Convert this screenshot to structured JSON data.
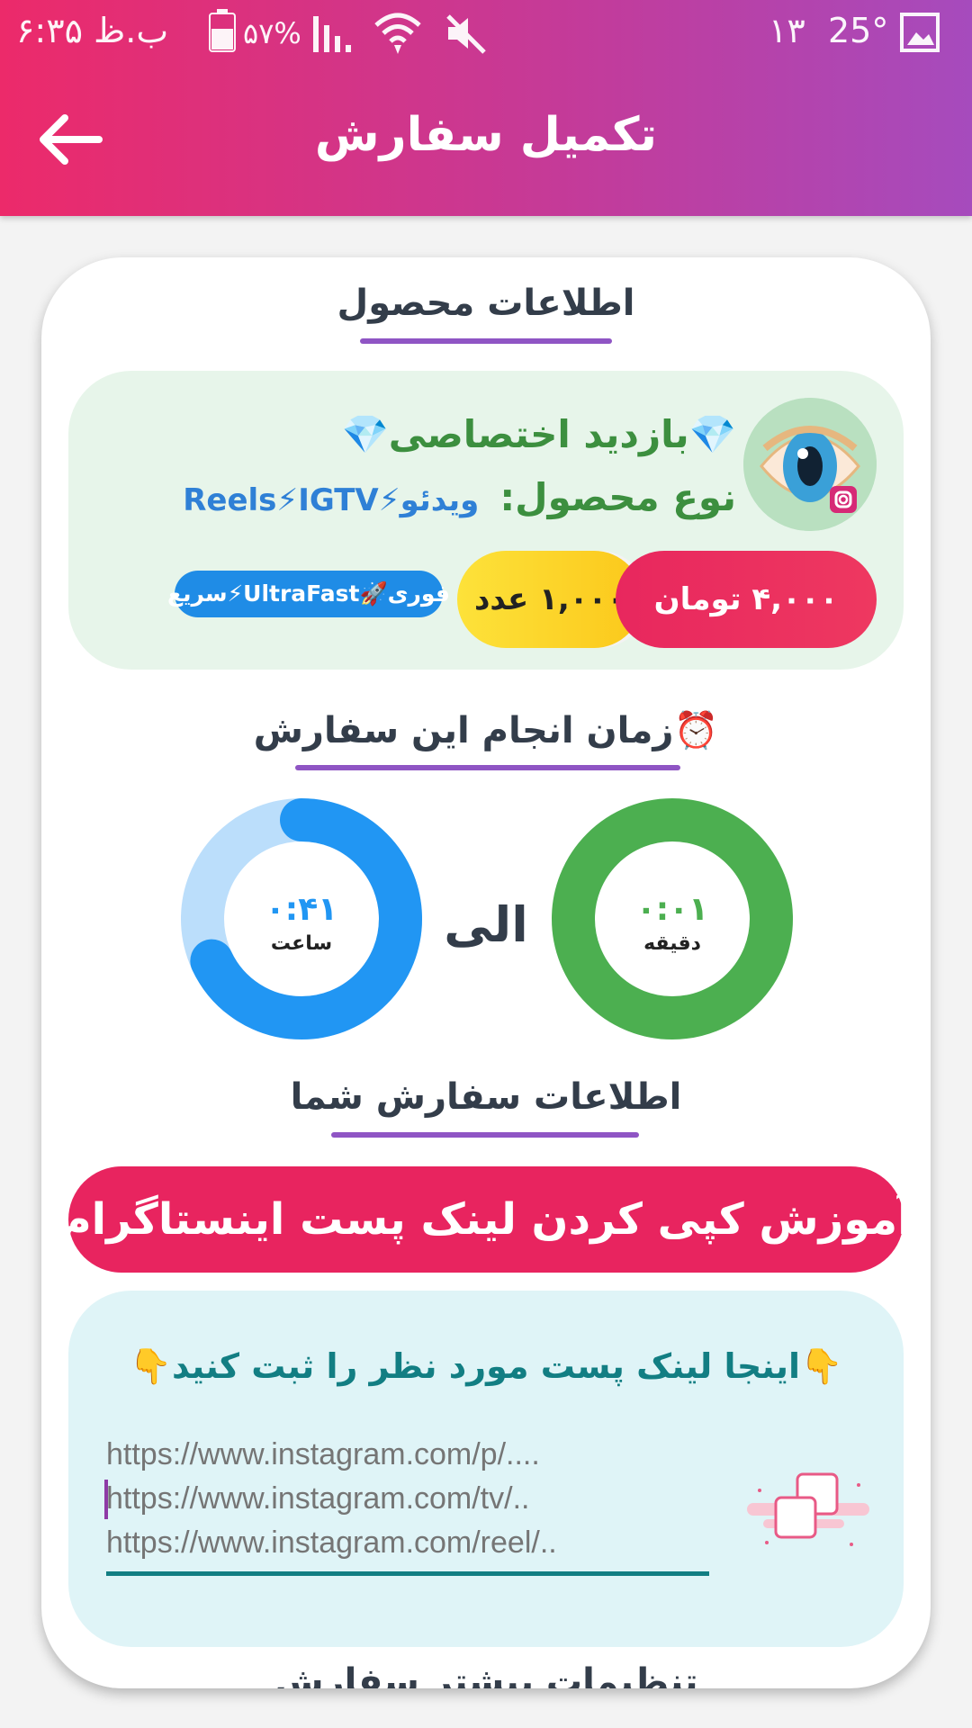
{
  "status_bar": {
    "time": "۶:۳۵ ب.ظ",
    "battery": "۵۷%",
    "notif_count": "۱۳",
    "temperature": "25°"
  },
  "app_bar": {
    "title": "تکمیل سفارش",
    "back_icon": "arrow-left-icon"
  },
  "product_section": {
    "title": "اطلاعات محصول",
    "name": "💎بازدید اختصاصی💎",
    "type_label": "نوع محصول:",
    "type_value": "ویدئو⚡Reels⚡IGTV",
    "price": "۴,۰۰۰ تومان",
    "quantity": "۱,۰۰۰ عدد",
    "speed_badge": "فوری🚀UltraFast⚡سریع",
    "avatar_icon": "eye-instagram-icon"
  },
  "time_section": {
    "title": "⏰زمان انجام این سفارش",
    "to_label": "الی",
    "min_value": "۰:۰۱",
    "min_unit": "دقیقه",
    "max_value": "۰:۴۱",
    "max_unit": "ساعت",
    "max_progress": 0.68,
    "colors": {
      "green": "#4caf50",
      "blue": "#2196f3",
      "blue_light": "#bbdefb"
    }
  },
  "order_section": {
    "title": "اطلاعات سفارش شما",
    "tutorial_button": "آموزش کپی کردن لینک پست اینستاگرام",
    "link_prompt": "👇اینجا لینک پست مورد نظر را ثبت کنید👇",
    "link_placeholder": "https://www.instagram.com/p/....\nhttps://www.instagram.com/tv/..\nhttps://www.instagram.com/reel/.."
  },
  "next_section": {
    "title": "تنظیمات بیشتر سفارش"
  },
  "accent_colors": {
    "gradient_start": "#ec2a6a",
    "gradient_end": "#a64bbd",
    "underline": "#8f55c4"
  }
}
